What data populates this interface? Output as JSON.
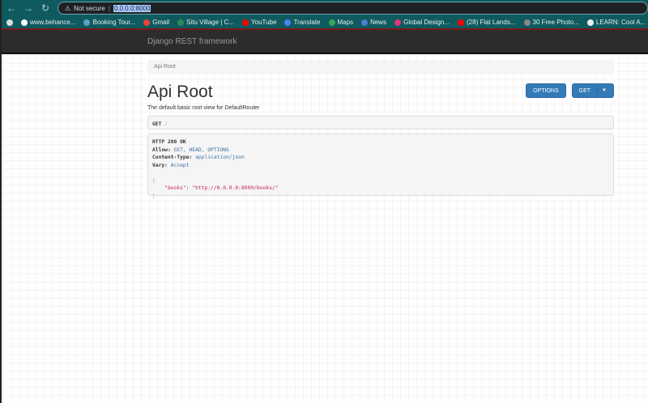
{
  "browser": {
    "security_label": "Not secure",
    "url": "0.0.0.0:8000",
    "bookmarks": [
      {
        "label": "www.behance...",
        "color": "#ffffff"
      },
      {
        "label": "Booking Tour...",
        "color": "#5aa0c8"
      },
      {
        "label": "Gmail",
        "color": "#ea4335"
      },
      {
        "label": "Situ Village | C...",
        "color": "#2a8a5a"
      },
      {
        "label": "YouTube",
        "color": "#ff0000"
      },
      {
        "label": "Translate",
        "color": "#4285f4"
      },
      {
        "label": "Maps",
        "color": "#34a853"
      },
      {
        "label": "News",
        "color": "#4a7fd6"
      },
      {
        "label": "Global Design...",
        "color": "#e0357a"
      },
      {
        "label": "(28) Flat Lands...",
        "color": "#ff0000"
      },
      {
        "label": "30 Free Photo...",
        "color": "#888888"
      },
      {
        "label": "LEARN: Cool A...",
        "color": "#eeeeee"
      }
    ]
  },
  "navbar": {
    "brand": "Django REST framework"
  },
  "breadcrumb": "Api Root",
  "page_title": "Api Root",
  "buttons": {
    "options": "OPTIONS",
    "get": "GET"
  },
  "description": "The default basic root view for DefaultRouter",
  "request": {
    "method": "GET",
    "path": "/"
  },
  "response": {
    "status": "HTTP 200 OK",
    "allow_key": "Allow:",
    "allow_val": "GET, HEAD, OPTIONS",
    "ctype_key": "Content-Type:",
    "ctype_val": "application/json",
    "vary_key": "Vary:",
    "vary_val": "Accept",
    "open_brace": "{",
    "json_key": "\"books\"",
    "json_colon": ": ",
    "json_val": "\"http://0.0.0.0:8000/books/\"",
    "close_brace": "}"
  }
}
